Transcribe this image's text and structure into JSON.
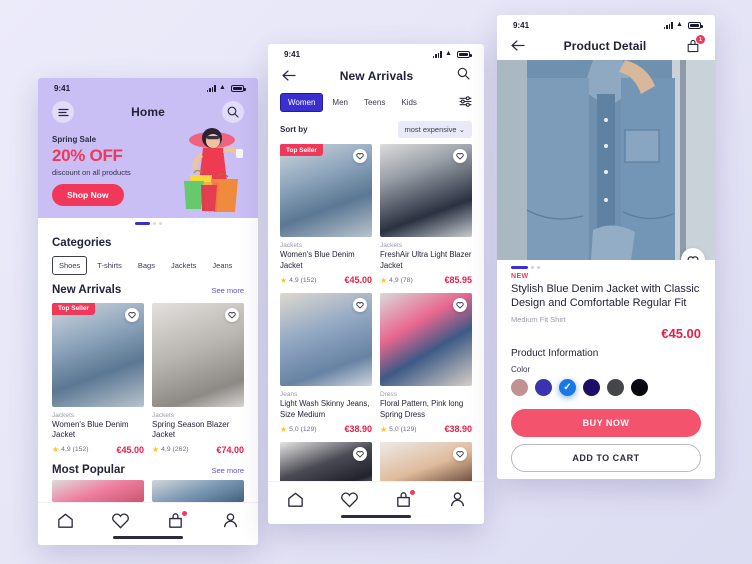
{
  "canvas": {
    "background": "#e8e8f8"
  },
  "phone_home": {
    "status": {
      "time": "9:41"
    },
    "nav": {
      "title": "Home",
      "menu_icon": "hamburger-icon",
      "search_icon": "search-icon"
    },
    "hero": {
      "eyebrow": "Spring Sale",
      "headline": "20% OFF",
      "subtext": "discount on all products",
      "cta": "Shop Now",
      "bg_color": "#c9bff4",
      "accent": "#f2385a"
    },
    "categories": {
      "title": "Categories",
      "items": [
        {
          "label": "Shoes",
          "selected": true
        },
        {
          "label": "T-shirts",
          "selected": false
        },
        {
          "label": "Bags",
          "selected": false
        },
        {
          "label": "Jackets",
          "selected": false
        },
        {
          "label": "Jeans",
          "selected": false
        }
      ]
    },
    "new_arrivals": {
      "title": "New Arrivals",
      "see_more": "See more",
      "products": [
        {
          "badge": "Top Seller",
          "category": "Jackets",
          "name": "Women's Blue Denim Jacket",
          "rating": "4,9",
          "reviews": "(152)",
          "price": "€45.00",
          "image": "im-denim"
        },
        {
          "badge": "",
          "category": "Jackets",
          "name": "Spring Season Blazer Jacket",
          "rating": "4,9",
          "reviews": "(262)",
          "price": "€74.00",
          "image": "im-gray"
        }
      ]
    },
    "most_popular": {
      "title": "Most Popular",
      "see_more": "See more"
    },
    "tabbar": {
      "items": [
        "home-icon",
        "heart-icon",
        "cart-icon",
        "profile-icon"
      ],
      "cart_has_badge": true
    }
  },
  "phone_list": {
    "status": {
      "time": "9:41"
    },
    "nav": {
      "title": "New Arrivals",
      "back_icon": "back-arrow-icon",
      "search_icon": "search-icon"
    },
    "filters": {
      "chips": [
        {
          "label": "Women",
          "selected": true
        },
        {
          "label": "Men",
          "selected": false
        },
        {
          "label": "Teens",
          "selected": false
        },
        {
          "label": "Kids",
          "selected": false
        }
      ],
      "filter_icon": "filter-sliders-icon"
    },
    "sort": {
      "label": "Sort by",
      "value": "most expensive"
    },
    "products": [
      {
        "badge": "Top Seller",
        "category": "Jackets",
        "name": "Women's Blue Denim Jacket",
        "rating": "4,9",
        "reviews": "(152)",
        "price": "€45.00",
        "image": "im-denim"
      },
      {
        "badge": "",
        "category": "Jackets",
        "name": "FreshAir Ultra Light Blazer Jacket",
        "rating": "4,9",
        "reviews": "(78)",
        "price": "€85.95",
        "image": "im-navy"
      },
      {
        "badge": "",
        "category": "Jeans",
        "name": "Light Wash Skinny Jeans, Size Medium",
        "rating": "5,0",
        "reviews": "(129)",
        "price": "€38.90",
        "image": "im-jeans"
      },
      {
        "badge": "",
        "category": "Dress",
        "name": "Floral Pattern, Pink long Spring Dress",
        "rating": "5,0",
        "reviews": "(129)",
        "price": "€38.90",
        "image": "im-floral"
      },
      {
        "badge": "",
        "category": "",
        "name": "",
        "rating": "",
        "reviews": "",
        "price": "",
        "image": "im-coat"
      },
      {
        "badge": "",
        "category": "",
        "name": "",
        "rating": "",
        "reviews": "",
        "price": "",
        "image": "im-shoe"
      }
    ],
    "tabbar": {
      "items": [
        "home-icon",
        "heart-icon",
        "cart-icon",
        "profile-icon"
      ],
      "cart_has_badge": true
    }
  },
  "phone_detail": {
    "status": {
      "time": "9:41"
    },
    "nav": {
      "title": "Product Detail",
      "back_icon": "back-arrow-icon",
      "cart_icon": "cart-icon",
      "cart_count": "1"
    },
    "product": {
      "tag": "NEW",
      "title": "Stylish Blue Denim Jacket with Classic Design and Comfortable Regular Fit",
      "subtitle": "Medium Fit Shirt",
      "price": "€45.00",
      "section_title": "Product Information",
      "color_label": "Color",
      "colors": [
        {
          "hex": "#c09292",
          "selected": false
        },
        {
          "hex": "#3b33b0",
          "selected": false
        },
        {
          "hex": "#1878e8",
          "selected": true
        },
        {
          "hex": "#1c0d66",
          "selected": false
        },
        {
          "hex": "#44464a",
          "selected": false
        },
        {
          "hex": "#080812",
          "selected": false
        }
      ]
    },
    "actions": {
      "buy": "BUY NOW",
      "add_to_cart": "ADD TO CART",
      "buy_color": "#f4536e"
    }
  }
}
